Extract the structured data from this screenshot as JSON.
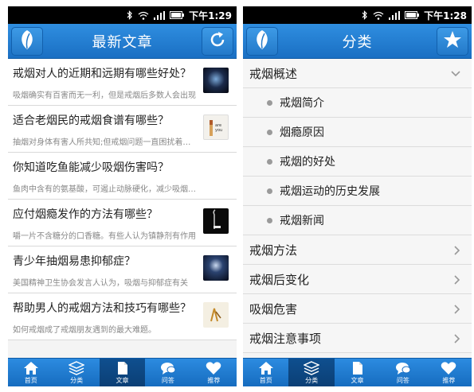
{
  "status": {
    "time": "下午1:29",
    "time_right": "下午1:28"
  },
  "left": {
    "title": "最新文章",
    "articles": [
      {
        "title": "戒烟对人的近期和远期有哪些好处？",
        "summary": "吸烟确实有百害而无一利，但是戒烟后多数人会出现"
      },
      {
        "title": "适合老烟民的戒烟食谱有哪些？",
        "summary": "抽烟对身体有害人所共知;但戒烟问题一直困扰着人们"
      },
      {
        "title": "你知道吃鱼能减少吸烟伤害吗？",
        "summary": "鱼肉中含有的氨基酸，可遏止动脉硬化，减少吸烟伤害"
      },
      {
        "title": "应付烟瘾发作的方法有哪些？",
        "summary": "嚼一片不含糖分的口香糖。有些人认为镇静剂有作用"
      },
      {
        "title": "青少年抽烟易患抑郁症？",
        "summary": "美国精神卫生协会发言人认为，吸烟与抑郁症有关"
      },
      {
        "title": "帮助男人的戒烟方法和技巧有哪些？",
        "summary": "如何戒烟成了戒烟朋友遇到的最大难题。"
      }
    ]
  },
  "right": {
    "title": "分类",
    "categories": [
      {
        "label": "戒烟概述",
        "sub": [
          "戒烟简介",
          "烟瘾原因",
          "戒烟的好处",
          "戒烟运动的历史发展",
          "戒烟新闻"
        ]
      },
      {
        "label": "戒烟方法"
      },
      {
        "label": "戒烟后变化"
      },
      {
        "label": "吸烟危害"
      },
      {
        "label": "戒烟注意事项"
      }
    ]
  },
  "tabs": {
    "home": "首页",
    "category": "分类",
    "article": "文章",
    "qa": "问答",
    "recommend": "推荐"
  },
  "colors": {
    "accent": "#1a6fc3",
    "active_tab": "#0b3f75"
  }
}
